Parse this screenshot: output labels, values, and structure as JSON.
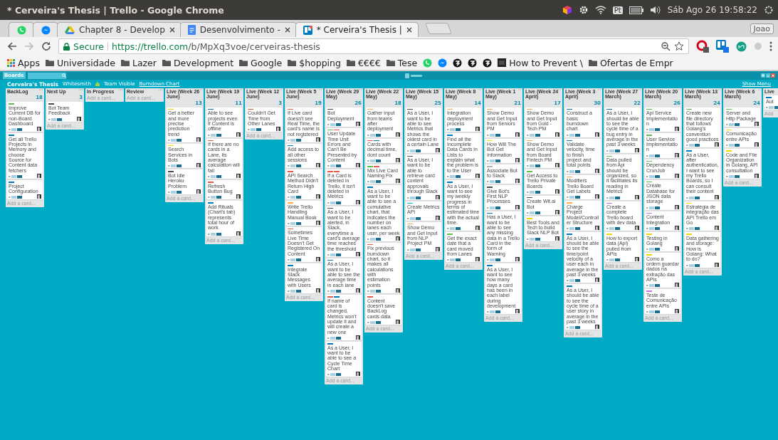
{
  "window": {
    "title": "* Cerveira's Thesis | Trello - Google Chrome"
  },
  "tray": {
    "keyboard": "Pt",
    "clock": "Sáb Ago 26 19:58:22"
  },
  "tabs": [
    {
      "selected": false
    },
    {
      "selected": false
    },
    {
      "title": "Chapter 8 - Develop",
      "selected": false
    },
    {
      "title": "Desenvolvimento -",
      "selected": false
    },
    {
      "title": "* Cerveira's Thesis |",
      "selected": true
    }
  ],
  "profile": "Joao",
  "address": {
    "secure": "Secure",
    "host": "https://trello.com",
    "path": "/b/MpXq3voe/cerveiras-thesis"
  },
  "bookmarks": [
    {
      "kind": "apps",
      "label": "Apps"
    },
    {
      "kind": "folder",
      "label": "Universidade"
    },
    {
      "kind": "folder",
      "label": "Lazer"
    },
    {
      "kind": "folder",
      "label": "Development"
    },
    {
      "kind": "folder",
      "label": "Google"
    },
    {
      "kind": "folder",
      "label": "$hopping"
    },
    {
      "kind": "folder",
      "label": "€€€€"
    },
    {
      "kind": "folder",
      "label": "Tese"
    },
    {
      "kind": "chat"
    },
    {
      "kind": "messenger"
    },
    {
      "kind": "mark"
    },
    {
      "kind": "mark"
    },
    {
      "kind": "mark"
    },
    {
      "kind": "site",
      "label": "How to Prevent \\"
    },
    {
      "kind": "folder",
      "label": "Ofertas de Empr"
    }
  ],
  "board": {
    "boards_button": "Boards",
    "name": "Cerveira's Thesis",
    "team": "Whitesmith",
    "visibility": "Team Visible",
    "power_up": "Burndown Chart",
    "menu": "Show Menu",
    "lists": [
      {
        "title": "BackLog",
        "count": "18",
        "add_card": "Add a card...",
        "cards": [
          {
            "text": "Improve Current DB for non-Board Dashboard",
            "labels": [
              {
                "color": "#61bd4f"
              }
            ]
          },
          {
            "text": "Get all Trello Projects in Memory and choose Source for Content data fetchers",
            "labels": [
              {
                "color": "#0079bf"
              }
            ]
          },
          {
            "text": "Project Configuration",
            "labels": [
              {
                "color": "#0079bf"
              }
            ]
          }
        ]
      },
      {
        "title": "Next Up",
        "count": "3",
        "add_card": "Add a card...",
        "cards": [
          {
            "text": "Bot Team Feedback",
            "labels": [
              {
                "color": "#4d4d4d"
              }
            ]
          }
        ]
      },
      {
        "title": "In Progress",
        "add_card": "Add a card..."
      },
      {
        "title": "Review",
        "add_card": "Add a card..."
      },
      {
        "title": "Live (Week 26 June)",
        "count": "13",
        "add_card": "Add a card...",
        "cards": [
          {
            "text": "Get a better and more precise prediction trend",
            "labels": [
              {
                "color": "#f2d600"
              }
            ]
          },
          {
            "text": "Search Services in Bots",
            "labels": [
              {
                "color": "#f2d600"
              }
            ]
          },
          {
            "text": "Bot Idle Heroku Problem",
            "labels": [
              {
                "color": "#4d4d4d"
              }
            ]
          }
        ]
      },
      {
        "title": "Live (Week 19 June)",
        "count": "11",
        "add_card": "Add a card...",
        "cards": [
          {
            "text": "Able to see projects even if Content is offline",
            "labels": [
              {
                "color": "#0079bf"
              }
            ]
          },
          {
            "text": "If there are no cards in a Lane, its average calculation will fail",
            "labels": [
              {
                "color": "#eb5a46"
              }
            ]
          },
          {
            "text": "Refresh Button Bug",
            "labels": [
              {
                "color": "#eb5a46"
              }
            ]
          },
          {
            "text": "Add Rituals (Chart's tab) represents total hour of work",
            "labels": [
              {
                "color": "#0079bf"
              }
            ]
          }
        ]
      },
      {
        "title": "Live (Week 12 June)",
        "count": "3",
        "add_card": "Add a card...",
        "cards": [
          {
            "text": "Couldn't Get Time from Other Lanes",
            "labels": [
              {
                "color": "#eb5a46"
              }
            ]
          }
        ]
      },
      {
        "title": "Live (Week 5 June)",
        "count": "19",
        "add_card": "Add a card...",
        "cards": [
          {
            "text": "If Live card doesn't see Real Time, the card's name is not registered",
            "labels": [
              {
                "color": "#eb5a46"
              }
            ]
          },
          {
            "text": "Add access to all other sessions",
            "labels": [
              {
                "color": "#0079bf"
              }
            ]
          },
          {
            "text": "API Search Method Didn't Return High Card",
            "labels": [
              {
                "color": "#eb5a46"
              }
            ]
          },
          {
            "text": "Write Trello Handling Manual Book",
            "labels": [
              {
                "color": "#ffab4a"
              }
            ]
          },
          {
            "text": "Sometimes Live Time Doesn't Get Registered On Content",
            "labels": [
              {
                "color": "#eb5a46"
              }
            ]
          },
          {
            "text": "Integrate Slack Messages with Users",
            "labels": [
              {
                "color": "#0079bf"
              }
            ]
          }
        ]
      },
      {
        "title": "Live (Week 29 May)",
        "count": "26",
        "add_card": "Add a card...",
        "cards": [
          {
            "text": "Bot Deployment",
            "labels": [
              {
                "color": "#4d4d4d"
              }
            ]
          },
          {
            "text": "User Update Time Unit Errors and Can't Be Presented by Content",
            "labels": [
              {
                "color": "#61bd4f"
              },
              {
                "color": "#eb5a46"
              }
            ]
          },
          {
            "text": "If a Card is deleted in Trello, it isn't deleted in Metrics",
            "labels": [
              {
                "color": "#eb5a46"
              },
              {
                "color": "#eb5a46"
              }
            ]
          },
          {
            "text": "As a User, I want to be alerted, in Slack, everytime a card's average time reaches the threshold",
            "labels": [
              {
                "color": "#4d4d4d"
              }
            ]
          },
          {
            "text": "As a User, I want to be able to see the average time in each lane",
            "labels": [
              {
                "color": "#0079bf"
              }
            ]
          },
          {
            "text": "If name of card is changed, Metrics won't update it and will create a new one",
            "labels": [
              {
                "color": "#eb5a46"
              },
              {
                "color": "#0079bf"
              }
            ]
          },
          {
            "text": "As a User, I want to be able to see a Cycle Time Chart",
            "labels": [
              {
                "color": "#0079bf"
              }
            ]
          }
        ]
      },
      {
        "title": "Live (Week 22 May)",
        "count": "18",
        "add_card": "Add a card...",
        "cards": [
          {
            "text": "Gather input from teams after deployment",
            "labels": [
              {
                "color": "#ffab4a"
              }
            ]
          },
          {
            "text": "Cards with decimal time, dont count",
            "labels": [
              {
                "color": "#eb5a46"
              },
              {
                "color": "#0079bf"
              }
            ]
          },
          {
            "text": "Mix Live Card Naming Fix",
            "labels": [
              {
                "color": "#61bd4f"
              },
              {
                "color": "#eb5a46"
              }
            ]
          },
          {
            "text": "As a User, I want to be able to see a cumulative chart, that indicates the number on lanes each user, per week",
            "labels": [
              {
                "color": "#0079bf"
              }
            ]
          },
          {
            "text": "Fix previous burndown chart, so it makes all calculations with estimation points",
            "labels": [
              {
                "color": "#eb5a46"
              }
            ]
          },
          {
            "text": "Content doesn't save BackLog cards data",
            "labels": [
              {
                "color": "#eb5a46"
              }
            ]
          }
        ]
      },
      {
        "title": "Live (Week 15 May)",
        "count": "25",
        "add_card": "Add a card...",
        "cards": [
          {
            "text": "As a User, I want to be able to see Metrics that shows the oldest card in a certain Lane",
            "labels": [
              {
                "color": "#4d4d4d"
              }
            ]
          },
          {
            "text": "As a User, I want to be able to retrieve card content approvals through Slack",
            "labels": [
              {
                "color": "#4d4d4d"
              }
            ]
          },
          {
            "text": "Create Metrics API",
            "labels": [
              {
                "color": "#00c2e0"
              }
            ]
          },
          {
            "text": "Show Demo and Get Input from NLP Project PM",
            "labels": [
              {
                "color": "#ffab4a"
              }
            ]
          }
        ]
      },
      {
        "title": "Live (Week 8 May)",
        "count": "14",
        "add_card": "Add a card...",
        "cards": [
          {
            "text": "Integration deployment process",
            "labels": [
              {
                "color": "#ffab4a"
              }
            ]
          },
          {
            "text": "Find all the Incomplete Data Cards in Lists to explain what the problem is to the User",
            "labels": [
              {
                "color": "#0079bf"
              }
            ]
          },
          {
            "text": "As a User, I want to see my weekly progress in terms of estimated time with the actual time.",
            "labels": [
              {
                "color": "#0079bf"
              }
            ]
          },
          {
            "text": "Get the exact date that a card moved from Lanes",
            "labels": [
              {
                "color": "#61bd4f"
              }
            ]
          }
        ]
      },
      {
        "title": "Live (Week 1 May)",
        "count": "21",
        "add_card": "Add a card...",
        "cards": [
          {
            "text": "Show Demo and Get Input from Seniors PM",
            "labels": [
              {
                "color": "#ffab4a"
              }
            ]
          },
          {
            "text": "How Will The Bot Get Information",
            "labels": [
              {
                "color": "#f2d600"
              }
            ]
          },
          {
            "text": "Associate Bot to Slack",
            "labels": [
              {
                "color": "#b3b3b3"
              }
            ]
          },
          {
            "text": "Give Bot's First NLP Processes",
            "labels": [
              {
                "color": "#4d4d4d"
              }
            ]
          },
          {
            "text": "Has a User, I want to be able to see any missing data in a Trello Card in the form of Warning",
            "labels": [
              {
                "color": "#0079bf"
              }
            ]
          },
          {
            "text": "As a User, I want to see how many days a card has been in each label during development",
            "labels": [
              {
                "color": "#0079bf"
              }
            ]
          }
        ]
      },
      {
        "title": "Live (Week 24 April)",
        "count": "17",
        "add_card": "Add a card...",
        "cards": [
          {
            "text": "Show Demo and Get Input from Gold - Tech PM",
            "labels": [
              {
                "color": "#ffab4a"
              }
            ]
          },
          {
            "text": "Show Demo and Get Input from Board Fintech PM",
            "labels": [
              {
                "color": "#ffab4a"
              }
            ]
          },
          {
            "text": "Get Access to Trello Private Boards",
            "labels": [
              {
                "color": "#61bd4f"
              }
            ]
          },
          {
            "text": "Create Wit.ai Bot",
            "labels": [
              {
                "color": "#4d4d4d"
              }
            ]
          },
          {
            "text": "Best Tools and Tech to build Slack NLP Bot",
            "labels": [
              {
                "color": "#f2d600"
              }
            ]
          }
        ]
      },
      {
        "title": "Live (Week 3 April)",
        "count": "30",
        "add_card": "Add a card...",
        "cards": [
          {
            "text": "Construct a basic burndown chart",
            "labels": [
              {
                "color": "#0079bf"
              }
            ]
          },
          {
            "text": "Validate velocity, time to finish project and total points",
            "labels": [
              {
                "color": "#0079bf"
              }
            ]
          },
          {
            "text": "Modifiers Trello Board Get Labels",
            "labels": [
              {
                "color": "#ffab4a"
              }
            ]
          },
          {
            "text": "Charge Project Model/Controller Structure",
            "labels": [
              {
                "color": "#ffab4a"
              }
            ]
          },
          {
            "text": "As a User, I should be able to see the time/point velocity of a user each in average in the past 3 weeks",
            "labels": [
              {
                "color": "#0079bf"
              }
            ]
          },
          {
            "text": "As a User, I should be able to see the cycle time of a user story in average in the past 3 weeks",
            "labels": [
              {
                "color": "#0079bf"
              }
            ]
          }
        ]
      },
      {
        "title": "Live (Week 27 March)",
        "count": "22",
        "add_card": "Add a card...",
        "cards": [
          {
            "text": "As a User, I should be able to see the cycle time of a bug entry in average in the past 3 weeks",
            "labels": [
              {
                "color": "#0079bf"
              }
            ]
          },
          {
            "text": "Data pulled from Api should be organized, so it facilitates its reading in Metrics",
            "labels": [
              {
                "color": "#61bd4f"
              }
            ]
          },
          {
            "text": "Create a complete Trello board with dev data",
            "labels": [
              {
                "color": "#c377e0"
              }
            ]
          },
          {
            "text": "How to export data (Api) pulled from APIs",
            "labels": [
              {
                "color": "#f2d600"
              }
            ]
          }
        ]
      },
      {
        "title": "Live (Week 20 March)",
        "count": "26",
        "add_card": "Add a card...",
        "cards": [
          {
            "text": "Api Service Implementation",
            "labels": [
              {
                "color": "#61bd4f"
              }
            ]
          },
          {
            "text": "User Service Implementation",
            "labels": [
              {
                "color": "#61bd4f"
              }
            ]
          },
          {
            "text": "Dependency CronJob",
            "labels": [
              {
                "color": "#61bd4f"
              }
            ]
          },
          {
            "text": "Create Database for JSON data storage",
            "labels": [
              {
                "color": "#61bd4f"
              }
            ]
          },
          {
            "text": "Content Integration",
            "labels": [
              {
                "color": "#c377e0"
              }
            ]
          },
          {
            "text": "Testing in Golang",
            "labels": [
              {
                "color": "#f2d600"
              }
            ]
          },
          {
            "text": "Como a ordem guardar dados na extração das APIs",
            "labels": [
              {
                "color": "#f2d600"
              }
            ]
          },
          {
            "text": "Teste de Comunicação entre APIs",
            "labels": [
              {
                "color": "#c377e0"
              }
            ]
          }
        ]
      },
      {
        "title": "Live (Week 13 March)",
        "count": "24",
        "add_card": "Add a card...",
        "cards": [
          {
            "text": "Create new file directory that follows Golang's convention good practices",
            "labels": [
              {
                "color": "#61bd4f"
              }
            ]
          },
          {
            "text": "As a User, after authentication, I want to see my Trello Boards, so I can consult their content",
            "labels": [
              {
                "color": "#0079bf"
              }
            ]
          },
          {
            "text": "Estratégia de integração das API Trello em Go",
            "labels": [
              {
                "color": "#f2d600"
              }
            ]
          },
          {
            "text": "Data gathering and storage: How is Golang: What to do?",
            "labels": [
              {
                "color": "#f2d600"
              }
            ]
          }
        ]
      },
      {
        "title": "Live (Week 6 March)",
        "count": "24",
        "add_card": "Add a card...",
        "cards": [
          {
            "text": "Server and Http Package",
            "labels": [
              {
                "color": "#61bd4f"
              }
            ]
          },
          {
            "text": "Comunicação entre APIs",
            "labels": [
              {
                "color": "#f2d600"
              }
            ]
          },
          {
            "text": "Code and File Organization in Golang, API consultation",
            "labels": [
              {
                "color": "#f2d600"
              }
            ]
          }
        ]
      },
      {
        "title": "Live",
        "add_card": "Add",
        "cards": [
          {
            "text": "Aut",
            "labels": [
              {
                "color": "#0079bf"
              }
            ]
          }
        ]
      }
    ]
  }
}
